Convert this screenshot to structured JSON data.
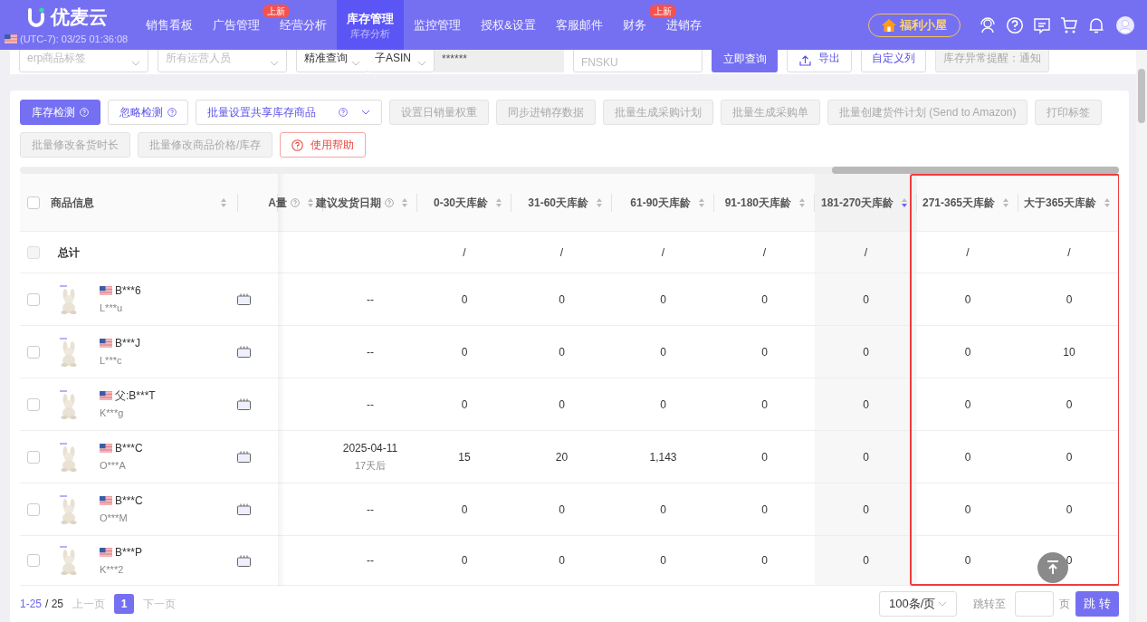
{
  "header": {
    "logo": "优麦云",
    "timezone": "(UTC-7): 03/25 01:36:08",
    "promo": "福利小屋",
    "nav": [
      {
        "label": "销售看板",
        "selected": false
      },
      {
        "label": "广告管理",
        "selected": false
      },
      {
        "label": "经营分析",
        "selected": false,
        "badge": "上新"
      },
      {
        "label": "库存管理",
        "selected": true,
        "sub": "库存分析"
      },
      {
        "label": "监控管理",
        "selected": false
      },
      {
        "label": "授权&设置",
        "selected": false
      },
      {
        "label": "客服邮件",
        "selected": false
      },
      {
        "label": "财务",
        "selected": false
      },
      {
        "label": "进销存",
        "selected": false,
        "badge": "上新"
      }
    ]
  },
  "filters": [
    {
      "kind": "select",
      "placeholder": "erp商品标签"
    },
    {
      "kind": "select",
      "placeholder": "所有运营人员"
    },
    {
      "kind": "select",
      "value": "精准查询"
    },
    {
      "kind": "select",
      "value": "子ASIN"
    },
    {
      "kind": "masked",
      "value": "******"
    },
    {
      "kind": "input",
      "placeholder": "FNSKU"
    },
    {
      "kind": "primary",
      "label": "立即查询"
    },
    {
      "kind": "export",
      "label": "导出"
    },
    {
      "kind": "button",
      "label": "自定义列"
    },
    {
      "kind": "disabled",
      "label": "库存异常提醒：通知"
    }
  ],
  "toolbar": [
    [
      {
        "kind": "primary",
        "label": "库存检测",
        "help": true
      },
      {
        "kind": "outline",
        "label": "忽略检测",
        "help": true
      },
      {
        "kind": "dropdown",
        "label": "批量设置共享库存商品",
        "help": true
      },
      {
        "kind": "disabled",
        "label": "设置日销量权重",
        "help": false
      },
      {
        "kind": "disabled",
        "label": "同步进销存数据",
        "help": false
      },
      {
        "kind": "disabled",
        "label": "批量生成采购计划",
        "help": false
      },
      {
        "kind": "disabled",
        "label": "批量生成采购单",
        "help": false
      },
      {
        "kind": "disabled",
        "label": "批量创建货件计划 (Send to Amazon)",
        "help": false
      },
      {
        "kind": "disabled",
        "label": "打印标签",
        "help": false
      }
    ],
    [
      {
        "kind": "disabled",
        "label": "批量修改备货时长",
        "help": false
      },
      {
        "kind": "disabled",
        "label": "批量修改商品价格/库存",
        "help": false
      },
      {
        "kind": "help",
        "label": "使用帮助",
        "help": false
      }
    ]
  ],
  "table": {
    "header_checked": false,
    "columns": [
      {
        "label": "商品信息",
        "sorted": false
      },
      {
        "label": "A量",
        "help": true,
        "sorted": false
      },
      {
        "label": "建议发货日期",
        "help": true,
        "sorted": false
      },
      {
        "label": "0-30天库龄",
        "sorted": false
      },
      {
        "label": "31-60天库龄",
        "sorted": false
      },
      {
        "label": "61-90天库龄",
        "sorted": false
      },
      {
        "label": "91-180天库龄",
        "sorted": false
      },
      {
        "label": "181-270天库龄",
        "sorted": true
      },
      {
        "label": "271-365天库龄",
        "sorted": false,
        "highlighted": true
      },
      {
        "label": "大于365天库龄",
        "sorted": false,
        "highlighted": true
      }
    ],
    "total": {
      "checked": false,
      "label": "总计",
      "values": [
        "/",
        "/",
        "/",
        "/",
        "/",
        "/",
        "/"
      ]
    },
    "rows": [
      {
        "checked": false,
        "name": "B***6",
        "sub": "L***u",
        "date": "--",
        "values": [
          "0",
          "0",
          "0",
          "0",
          "0",
          "0",
          "0"
        ]
      },
      {
        "checked": false,
        "name": "B***J",
        "sub": "L***c",
        "date": "--",
        "values": [
          "0",
          "0",
          "0",
          "0",
          "0",
          "0",
          "10"
        ]
      },
      {
        "checked": false,
        "name": "父:B***T",
        "sub": "K***g",
        "date": "--",
        "values": [
          "0",
          "0",
          "0",
          "0",
          "0",
          "0",
          "0"
        ]
      },
      {
        "checked": false,
        "name": "B***C",
        "sub": "O***A",
        "date": "2025-04-11",
        "date_note": "17天后",
        "values": [
          "15",
          "20",
          "1,143",
          "0",
          "0",
          "0",
          "0"
        ]
      },
      {
        "checked": false,
        "name": "B***C",
        "sub": "O***M",
        "date": "--",
        "values": [
          "0",
          "0",
          "0",
          "0",
          "0",
          "0",
          "0"
        ]
      },
      {
        "checked": false,
        "name": "B***P",
        "sub": "K***2",
        "date": "--",
        "values": [
          "0",
          "0",
          "0",
          "0",
          "0",
          "0",
          "0"
        ]
      }
    ]
  },
  "pagination": {
    "range": "1-25",
    "total": "/ 25",
    "prev": "上一页",
    "pages": [
      {
        "label": "1",
        "selected": true
      }
    ],
    "next": "下一页",
    "page_size": "100条/页",
    "jump_label": "跳转至",
    "page_unit": "页",
    "jump_button": "跳 转"
  }
}
